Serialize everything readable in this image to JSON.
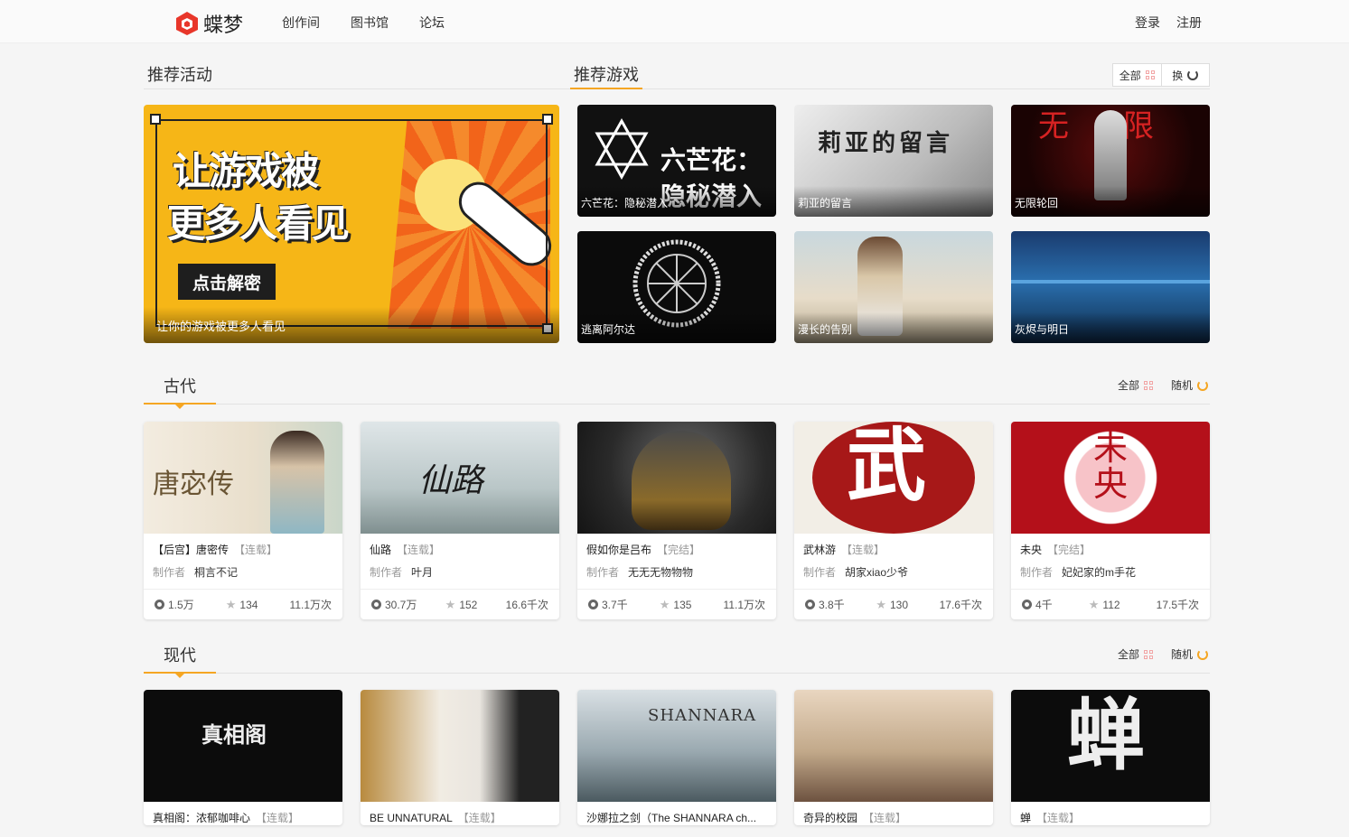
{
  "header": {
    "logo_text": "蝶梦",
    "nav": [
      "创作间",
      "图书馆",
      "论坛"
    ],
    "login": "登录",
    "register": "注册"
  },
  "recommend": {
    "activity_title": "推荐活动",
    "games_title": "推荐游戏",
    "all_label": "全部",
    "switch_label": "换",
    "banner": {
      "line1": "让游戏被",
      "line2": "更多人看见",
      "button": "点击解密",
      "caption": "让你的游戏被更多人看见"
    },
    "games": [
      {
        "name": "六芒花：隐秘潜入",
        "art": "六芒花：隐秘潜入"
      },
      {
        "name": "莉亚的留言",
        "art": "莉亚的留言"
      },
      {
        "name": "无限轮回",
        "art": "无限"
      },
      {
        "name": "逃离阿尔达",
        "art": ""
      },
      {
        "name": "漫长的告别",
        "art": ""
      },
      {
        "name": "灰烬与明日",
        "art": ""
      }
    ]
  },
  "sections": [
    {
      "title": "古代",
      "all_label": "全部",
      "random_label": "随机",
      "author_label": "制作者",
      "items": [
        {
          "title": "【后宫】唐密传",
          "status": "【连载】",
          "author": "桐言不记",
          "coins": "1.5万",
          "stars": "134",
          "plays": "11.1万次",
          "art": "唐宓传"
        },
        {
          "title": "仙路",
          "status": "【连载】",
          "author": "叶月",
          "coins": "30.7万",
          "stars": "152",
          "plays": "16.6千次",
          "art": "仙路"
        },
        {
          "title": "假如你是吕布",
          "status": "【完结】",
          "author": "无无无物物物",
          "coins": "3.7千",
          "stars": "135",
          "plays": "11.1万次",
          "art": ""
        },
        {
          "title": "武林游",
          "status": "【连载】",
          "author": "胡家xiao少爷",
          "coins": "3.8千",
          "stars": "130",
          "plays": "17.6千次",
          "art": "武"
        },
        {
          "title": "未央",
          "status": "【完结】",
          "author": "妃妃家的m手花",
          "coins": "4千",
          "stars": "112",
          "plays": "17.5千次",
          "art": "未央"
        }
      ]
    },
    {
      "title": "现代",
      "all_label": "全部",
      "random_label": "随机",
      "items": [
        {
          "title": "真相阁：浓郁咖啡心",
          "status": "【连载】",
          "art": "真相阁"
        },
        {
          "title": "BE UNNATURAL",
          "status": "【连载】",
          "art": ""
        },
        {
          "title": "沙娜拉之剑（The SHANNARA ch...",
          "status": "",
          "art": "SHANNARA"
        },
        {
          "title": "奇异的校园",
          "status": "【连载】",
          "art": ""
        },
        {
          "title": "蝉",
          "status": "【连载】",
          "art": "蝉"
        }
      ]
    }
  ],
  "colors": {
    "accent": "#f5a623",
    "brand": "#e8362a"
  }
}
